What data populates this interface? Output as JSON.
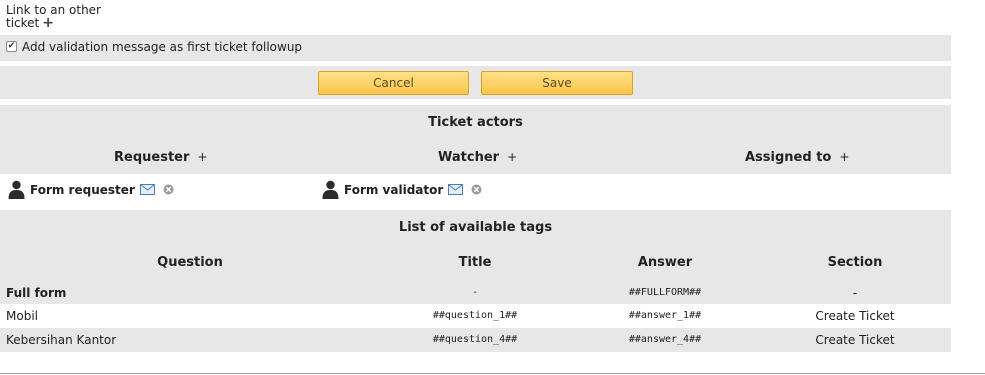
{
  "link_other_ticket": {
    "line1": "Link to an other",
    "line2": "ticket",
    "plus": "+"
  },
  "validation": {
    "checked": true,
    "check_mark": "✔",
    "label": "Add validation message as first ticket followup"
  },
  "buttons": {
    "cancel": "Cancel",
    "save": "Save"
  },
  "actors": {
    "title": "Ticket actors",
    "columns": [
      {
        "label": "Requester",
        "plus": "+"
      },
      {
        "label": "Watcher",
        "plus": "+"
      },
      {
        "label": "Assigned to",
        "plus": "+"
      }
    ],
    "entries": [
      {
        "name": "Form requester"
      },
      {
        "name": "Form validator"
      }
    ]
  },
  "tags": {
    "title": "List of available tags",
    "headers": [
      "Question",
      "Title",
      "Answer",
      "Section"
    ],
    "rows": [
      {
        "question": "Full form",
        "title": "-",
        "answer": "##FULLFORM##",
        "section": "-"
      },
      {
        "question": "Mobil",
        "title": "##question_1##",
        "answer": "##answer_1##",
        "section": "Create Ticket"
      },
      {
        "question": "Kebersihan Kantor",
        "title": "##question_4##",
        "answer": "##answer_4##",
        "section": "Create Ticket"
      }
    ]
  },
  "colors": {
    "band": "#e7e7e7",
    "button_top": "#ffe08a",
    "button_bottom": "#fcc54a",
    "button_border": "#d9a521"
  },
  "icons": [
    "person-icon",
    "mail-icon",
    "delete-icon",
    "plus-icon",
    "checkbox-icon"
  ]
}
